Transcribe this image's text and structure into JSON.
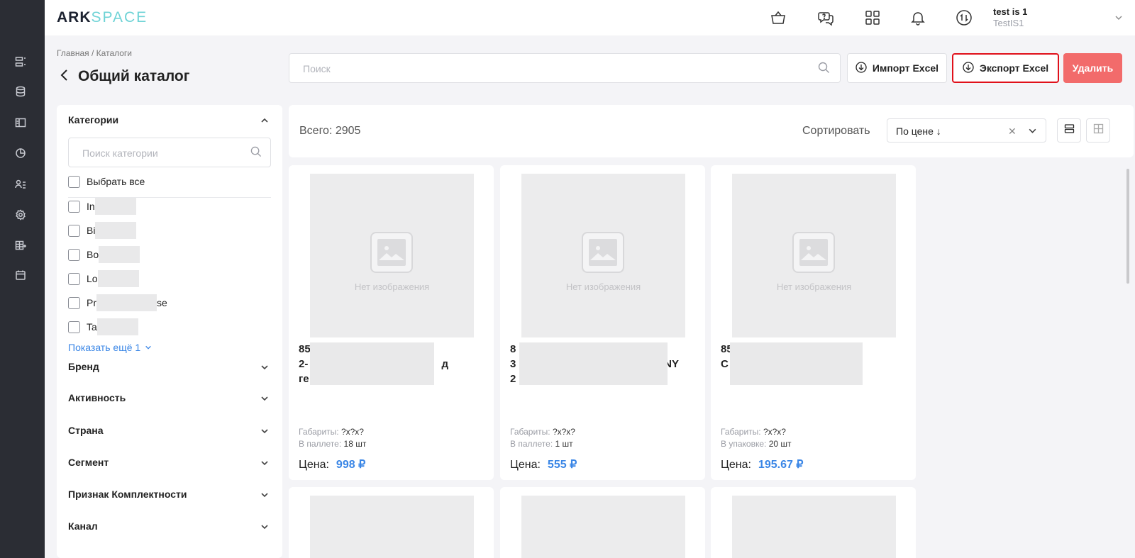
{
  "header": {
    "logo_bold": "ARK",
    "logo_light": "SPACE",
    "icons": [
      "basket-icon",
      "help-chat-icon",
      "apps-grid-icon",
      "bell-icon",
      "sync-icon"
    ],
    "user_name": "test is 1",
    "user_org": "TestIS1"
  },
  "page": {
    "breadcrumb": "Главная / Каталоги",
    "title": "Общий каталог"
  },
  "toolbar": {
    "search_placeholder": "Поиск",
    "import_label": "Импорт Excel",
    "export_label": "Экспорт Excel",
    "delete_label": "Удалить"
  },
  "filters": {
    "categories_title": "Категории",
    "category_search_placeholder": "Поиск категории",
    "select_all": "Выбрать все",
    "category_items": [
      "In",
      "Bi",
      "Bo",
      "Lo",
      "Pr",
      "Ta"
    ],
    "category_item_suffix_5": "se",
    "show_more": "Показать ещё 1",
    "sections": [
      "Бренд",
      "Активность",
      "Страна",
      "Сегмент",
      "Признак Комплектности",
      "Канал"
    ]
  },
  "listing": {
    "total": "Всего: 2905",
    "sort_label": "Сортировать",
    "sort_value": "По цене ↓",
    "no_image": "Нет изображения",
    "dims_label": "Габариты:",
    "price_label": "Цена:",
    "products": [
      {
        "name_line1": "85",
        "name_line2": "2-",
        "name_line2_tail": "д",
        "name_line3": "ге",
        "dims": "?x?x?",
        "pack_label": "В паллете:",
        "pack_value": "18 шт",
        "price": "998 ₽"
      },
      {
        "name_line1": "8",
        "name_line2": "3",
        "name_line2_tail": "NY",
        "name_line3": "2",
        "dims": "?x?x?",
        "pack_label": "В паллете:",
        "pack_value": "1 шт",
        "price": "555 ₽"
      },
      {
        "name_line1": "85",
        "name_line2": "C",
        "name_line2_tail": "",
        "name_line3": "",
        "dims": "?x?x?",
        "pack_label": "В упаковке:",
        "pack_value": "20 шт",
        "price": "195.67 ₽"
      }
    ]
  },
  "colors": {
    "rail": "#2b2d34",
    "accent": "#3a86e6",
    "delete": "#f26b6b",
    "highlight": "#e0101a"
  }
}
